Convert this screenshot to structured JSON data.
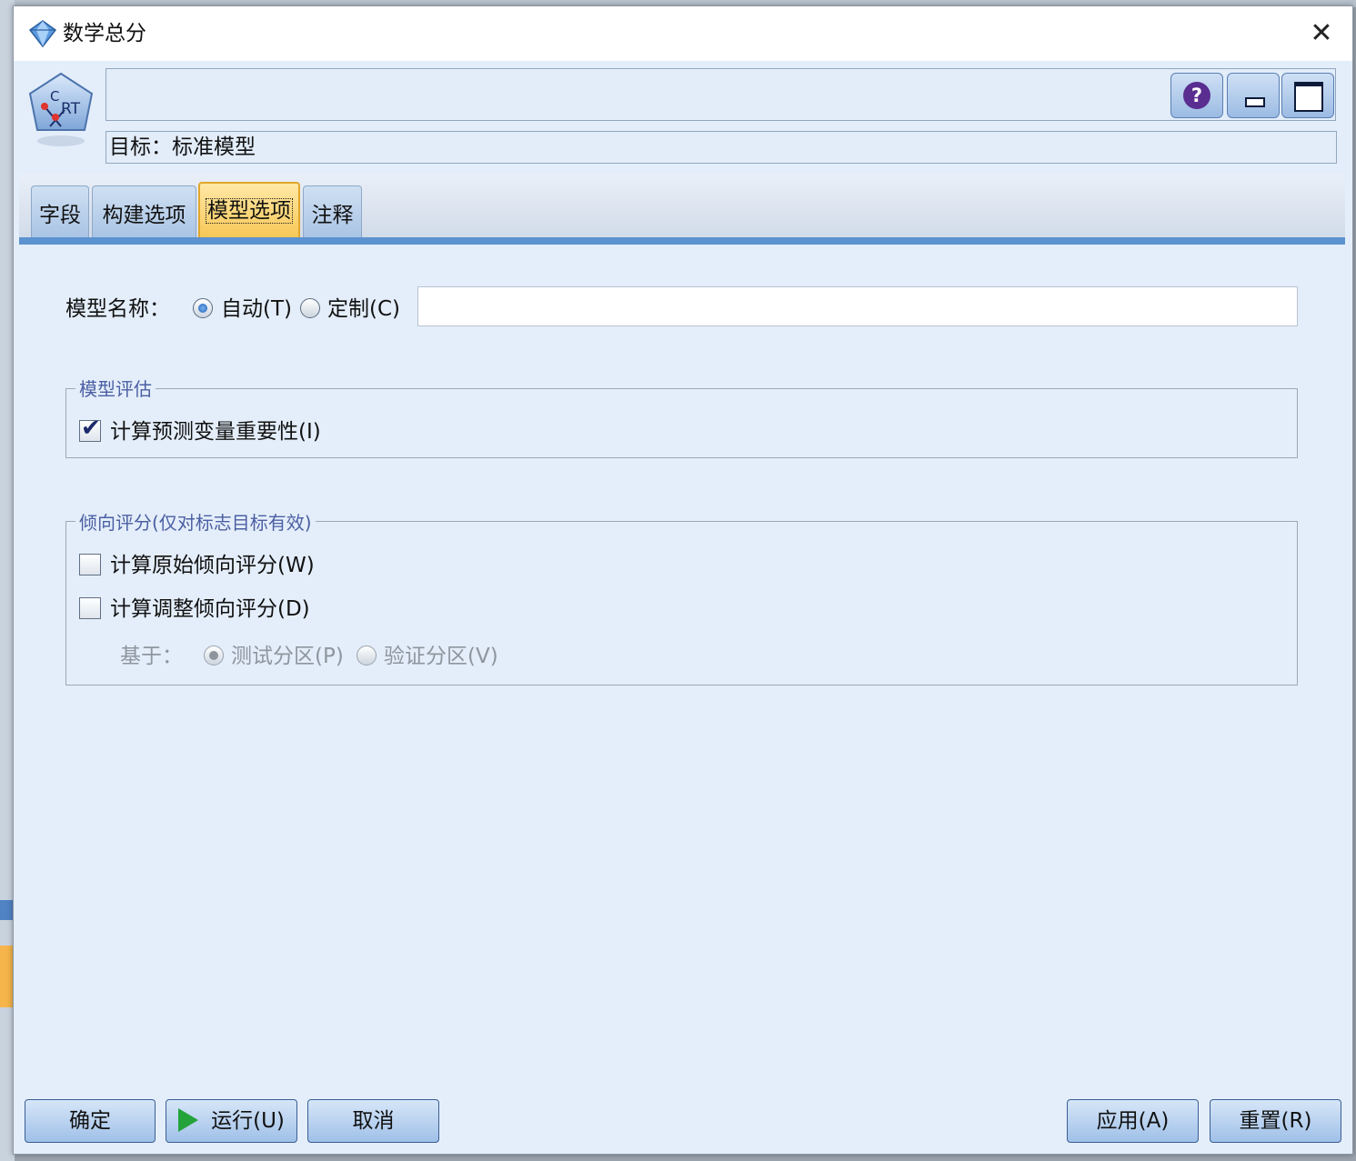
{
  "window": {
    "title": "数学总分"
  },
  "header": {
    "node_icon_text": "C RT",
    "target_label": "目标：标准模型"
  },
  "tabs": [
    {
      "label": "字段"
    },
    {
      "label": "构建选项"
    },
    {
      "label": "模型选项",
      "active": true
    },
    {
      "label": "注释"
    }
  ],
  "model_name": {
    "label": "模型名称：",
    "options": [
      {
        "label": "自动(T)",
        "selected": true
      },
      {
        "label": "定制(C)",
        "selected": false
      }
    ],
    "custom_value": ""
  },
  "model_evaluation": {
    "title": "模型评估",
    "compute_importance": {
      "label": "计算预测变量重要性(I)",
      "checked": true
    }
  },
  "propensity": {
    "title": "倾向评分(仅对标志目标有效)",
    "raw": {
      "label": "计算原始倾向评分(W)",
      "checked": false
    },
    "adjusted": {
      "label": "计算调整倾向评分(D)",
      "checked": false
    },
    "based_on": {
      "label": "基于：",
      "options": [
        {
          "label": "测试分区(P)",
          "selected": true
        },
        {
          "label": "验证分区(V)",
          "selected": false
        }
      ]
    }
  },
  "buttons": {
    "ok": "确定",
    "run": "运行(U)",
    "cancel": "取消",
    "apply": "应用(A)",
    "reset": "重置(R)"
  },
  "icons": {
    "title_icon": "diamond-icon",
    "help": "help-icon",
    "minimize": "minimize-icon",
    "maximize": "maximize-icon",
    "close": "close-icon",
    "run": "play-icon"
  },
  "colors": {
    "panel_bg": "#e4eefa",
    "active_tab": "#f7c550",
    "tab_underline": "#5c92cf",
    "group_title": "#4b5fa3"
  }
}
